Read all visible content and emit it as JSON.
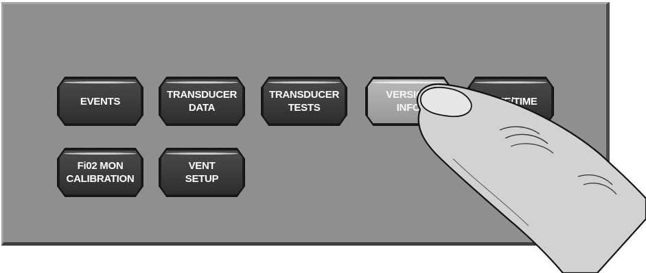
{
  "screen": {
    "title": "",
    "buttons": [
      {
        "id": "events",
        "label": "EVENTS",
        "pressed": false
      },
      {
        "id": "transducer-data",
        "label": "TRANSDUCER\nDATA",
        "pressed": false
      },
      {
        "id": "transducer-tests",
        "label": "TRANSDUCER\nTESTS",
        "pressed": false
      },
      {
        "id": "version-info",
        "label": "VERSION\nINFO",
        "pressed": true
      },
      {
        "id": "date-time",
        "label": "DATE/TIME",
        "pressed": false
      },
      {
        "id": "fio2-mon-calibration",
        "label": "Fi02 MON\nCALIBRATION",
        "pressed": false
      },
      {
        "id": "vent-setup",
        "label": "VENT\nSETUP",
        "pressed": false
      }
    ]
  },
  "colors": {
    "panel": "#8f8f8f",
    "key": "#3b3b3b",
    "key_pressed": "#a6a6a6",
    "key_text": "#ffffff"
  },
  "icons": {
    "finger": "pointing-finger-icon"
  }
}
